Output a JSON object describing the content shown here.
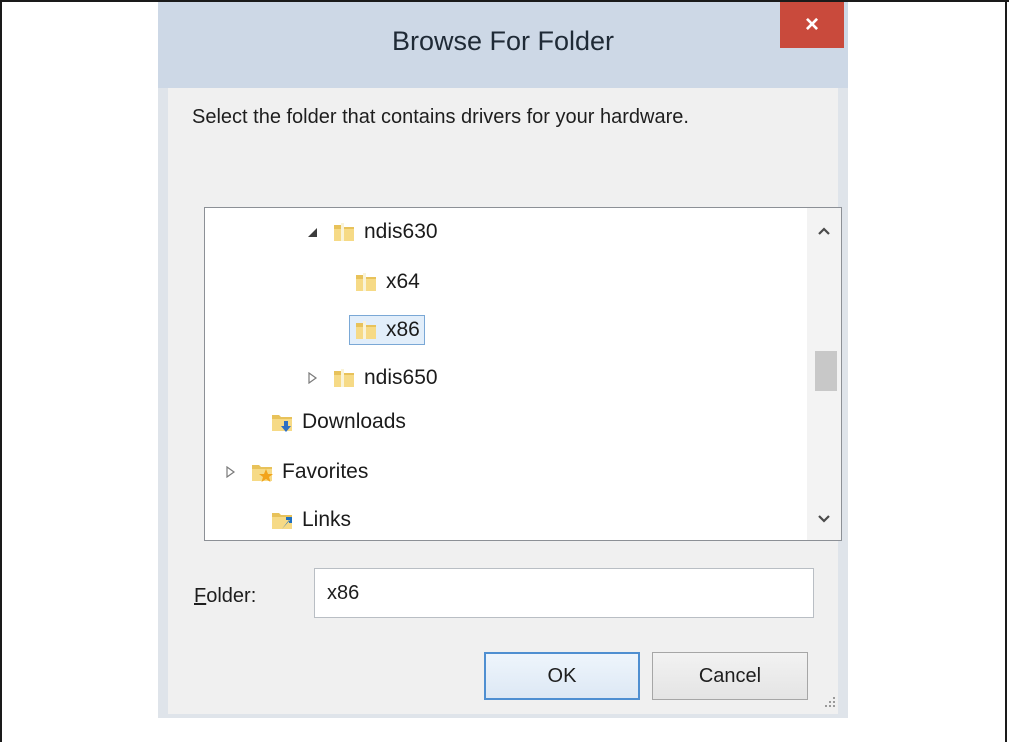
{
  "dialog": {
    "title": "Browse For Folder",
    "close_label": "×",
    "instruction": "Select the folder that contains drivers for your hardware."
  },
  "tree": {
    "items": [
      {
        "label": "ndis630",
        "expander": "expanded",
        "icon": "folder-icon"
      },
      {
        "label": "x64",
        "expander": "none",
        "icon": "folder-icon"
      },
      {
        "label": "x86",
        "expander": "none",
        "icon": "folder-icon",
        "selected": true
      },
      {
        "label": "ndis650",
        "expander": "collapsed",
        "icon": "folder-icon"
      },
      {
        "label": "Downloads",
        "expander": "none",
        "icon": "downloads-folder-icon"
      },
      {
        "label": "Favorites",
        "expander": "collapsed",
        "icon": "favorites-folder-icon"
      },
      {
        "label": "Links",
        "expander": "none",
        "icon": "links-folder-icon"
      }
    ]
  },
  "folder_field": {
    "label_accel": "F",
    "label_rest": "older:",
    "value": "x86"
  },
  "buttons": {
    "ok": "OK",
    "cancel": "Cancel"
  },
  "colors": {
    "close_button": "#c94a3c",
    "selection_border": "#7aa8d6",
    "ok_border": "#4f8fd1"
  }
}
